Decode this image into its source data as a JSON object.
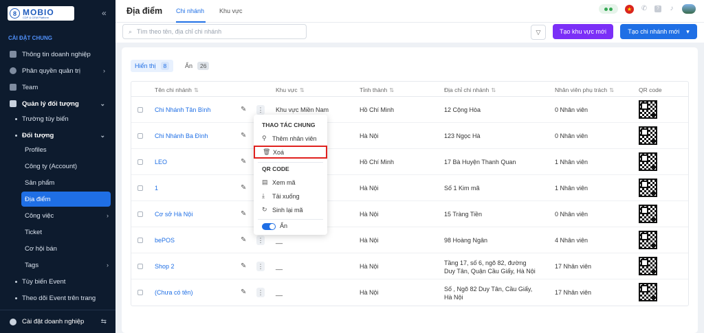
{
  "app": {
    "logo_badge": "8",
    "logo_name": "MOBIO",
    "logo_sub": "CDP & CEM Platform",
    "collapse": "«"
  },
  "sidebar": {
    "section_title": "CÀI ĐẶT CHUNG",
    "items": [
      {
        "label": "Thông tin doanh nghiệp"
      },
      {
        "label": "Phân quyền quản trị"
      },
      {
        "label": "Team"
      },
      {
        "label": "Quản lý đối tượng"
      },
      {
        "label": "Trường tùy biến"
      },
      {
        "label": "Đối tượng"
      },
      {
        "label": "Profiles"
      },
      {
        "label": "Công ty (Account)"
      },
      {
        "label": "Sản phẩm"
      },
      {
        "label": "Địa điểm"
      },
      {
        "label": "Công việc"
      },
      {
        "label": "Ticket"
      },
      {
        "label": "Cơ hội bán"
      },
      {
        "label": "Tags"
      },
      {
        "label": "Tùy biến Event"
      },
      {
        "label": "Theo dõi Event trên trang"
      }
    ],
    "footer": "Cài đặt doanh nghiệp"
  },
  "header": {
    "title": "Địa điểm",
    "tabs": [
      "Chi nhánh",
      "Khu vực"
    ]
  },
  "toolbar": {
    "search_placeholder": "Tìm theo tên, địa chỉ chi nhánh",
    "create_region": "Tạo khu vực mới",
    "create_branch": "Tạo chi nhánh mới"
  },
  "view_tabs": [
    {
      "label": "Hiển thị",
      "count": "8"
    },
    {
      "label": "Ẩn",
      "count": "26"
    }
  ],
  "table": {
    "headers": [
      "Tên chi nhánh",
      "Khu vực",
      "Tỉnh thành",
      "Địa chỉ chi nhánh",
      "Nhân viên phụ trách",
      "QR code"
    ],
    "rows": [
      {
        "name": "Chi Nhánh Tân Bình",
        "region": "Khu vực Miền Nam",
        "province": "Hồ Chí Minh",
        "address": "12 Cộng Hòa",
        "staff": "0 Nhân viên"
      },
      {
        "name": "Chi Nhánh Ba Đình",
        "region": "",
        "province": "Hà Nội",
        "address": "123 Ngọc Hà",
        "staff": "0 Nhân viên"
      },
      {
        "name": "LEO",
        "region": "",
        "province": "Hồ Chí Minh",
        "address": "17 Bà Huyện Thanh Quan",
        "staff": "1 Nhân viên"
      },
      {
        "name": "1",
        "region": "",
        "province": "Hà Nội",
        "address": "Số 1 Kim mã",
        "staff": "1 Nhân viên"
      },
      {
        "name": "Cơ sở Hà Nội",
        "region": "",
        "province": "Hà Nội",
        "address": "15 Tràng Tiền",
        "staff": "0 Nhân viên"
      },
      {
        "name": "bePOS",
        "region": "__",
        "province": "Hà Nội",
        "address": "98 Hoàng Ngân",
        "staff": "4 Nhân viên"
      },
      {
        "name": "Shop 2",
        "region": "__",
        "province": "Hà Nội",
        "address": "Tầng 17, số 6, ngõ 82, đường Duy Tân, Quận Cầu Giấy, Hà Nội",
        "staff": "17 Nhân viên"
      },
      {
        "name": "(Chưa có tên)",
        "region": "__",
        "province": "Hà Nội",
        "address": "Số , Ngõ 82 Duy Tân, Cầu Giấy, Hà Nội",
        "staff": "17 Nhân viên"
      }
    ]
  },
  "context_menu": {
    "section1": "THAO TÁC CHUNG",
    "add_staff": "Thêm nhân viên",
    "delete": "Xoá",
    "section2": "QR CODE",
    "view_code": "Xem mã",
    "download": "Tải xuống",
    "regenerate": "Sinh lại mã",
    "hide": "Ẩn"
  }
}
